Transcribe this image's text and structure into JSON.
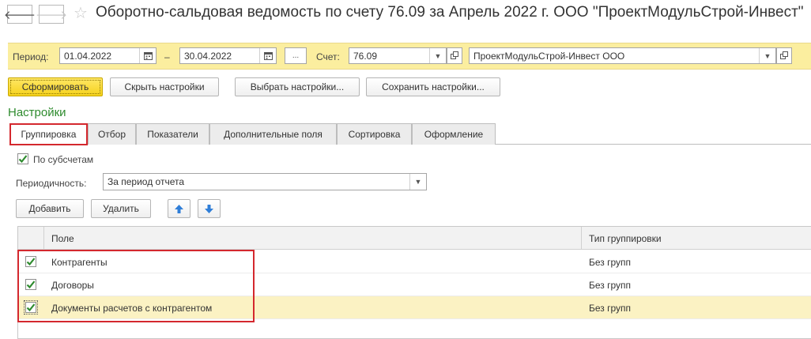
{
  "window": {
    "title": "Оборотно-сальдовая ведомость по счету 76.09 за Апрель 2022 г. ООО \"ПроектМодульСтрой-Инвест\"",
    "back_icon": "arrow-left-icon",
    "forward_icon": "arrow-right-icon",
    "favorite_icon": "star-icon"
  },
  "params": {
    "period_label": "Период:",
    "date_from": "01.04.2022",
    "dash": "–",
    "date_to": "30.04.2022",
    "ellipsis": "...",
    "account_label": "Счет:",
    "account_value": "76.09",
    "organization_value": "ПроектМодульСтрой-Инвест ООО"
  },
  "toolbar": {
    "generate": "Сформировать",
    "hide_settings": "Скрыть настройки",
    "choose_settings": "Выбрать настройки...",
    "save_settings": "Сохранить настройки..."
  },
  "settings": {
    "title": "Настройки",
    "tabs": [
      {
        "label": "Группировка",
        "active": true
      },
      {
        "label": "Отбор"
      },
      {
        "label": "Показатели"
      },
      {
        "label": "Дополнительные поля"
      },
      {
        "label": "Сортировка"
      },
      {
        "label": "Оформление"
      }
    ],
    "by_subaccounts_label": "По субсчетам",
    "by_subaccounts_checked": true,
    "periodicity_label": "Периодичность:",
    "periodicity_value": "За период отчета",
    "add_button": "Добавить",
    "delete_button": "Удалить",
    "move_up_icon": "arrow-up-icon",
    "move_down_icon": "arrow-down-icon"
  },
  "grid": {
    "columns": [
      "Поле",
      "Тип группировки"
    ],
    "rows": [
      {
        "field": "Контрагенты",
        "group_type": "Без групп",
        "checked": true
      },
      {
        "field": "Договоры",
        "group_type": "Без групп",
        "checked": true
      },
      {
        "field": "Документы расчетов с контрагентом",
        "group_type": "Без групп",
        "checked": true,
        "selected": true
      }
    ]
  },
  "colors": {
    "accent_green": "#2e8b2e",
    "highlight_red": "#d4282e",
    "param_band": "#fbee9f",
    "primary_button": "#f5d21c",
    "selected_row": "#fbf2c3",
    "arrow_blue": "#2f7ed8"
  }
}
